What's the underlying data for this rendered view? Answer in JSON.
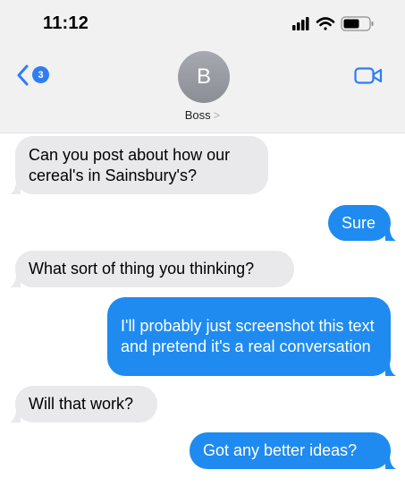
{
  "status_bar": {
    "time": "11:12",
    "icons": [
      "signal-icon",
      "wifi-icon",
      "battery-icon"
    ]
  },
  "header": {
    "back_badge_count": "3",
    "avatar_initial": "B",
    "contact_name": "Boss",
    "contact_chevron": ">"
  },
  "colors": {
    "incoming_bubble": "#e9e9eb",
    "outgoing_bubble": "#1f8bf0",
    "accent": "#2f7cf6"
  },
  "messages": [
    {
      "sender": "them",
      "text": "Can you post about how our cereal's in Sainsbury's?"
    },
    {
      "sender": "me",
      "text": "Sure"
    },
    {
      "sender": "them",
      "text": "What sort of thing you thinking?"
    },
    {
      "sender": "me",
      "text": "I'll probably just screenshot this text and pretend it's a real conversation"
    },
    {
      "sender": "them",
      "text": "Will that work?"
    },
    {
      "sender": "me",
      "text": "Got any better ideas?"
    }
  ]
}
